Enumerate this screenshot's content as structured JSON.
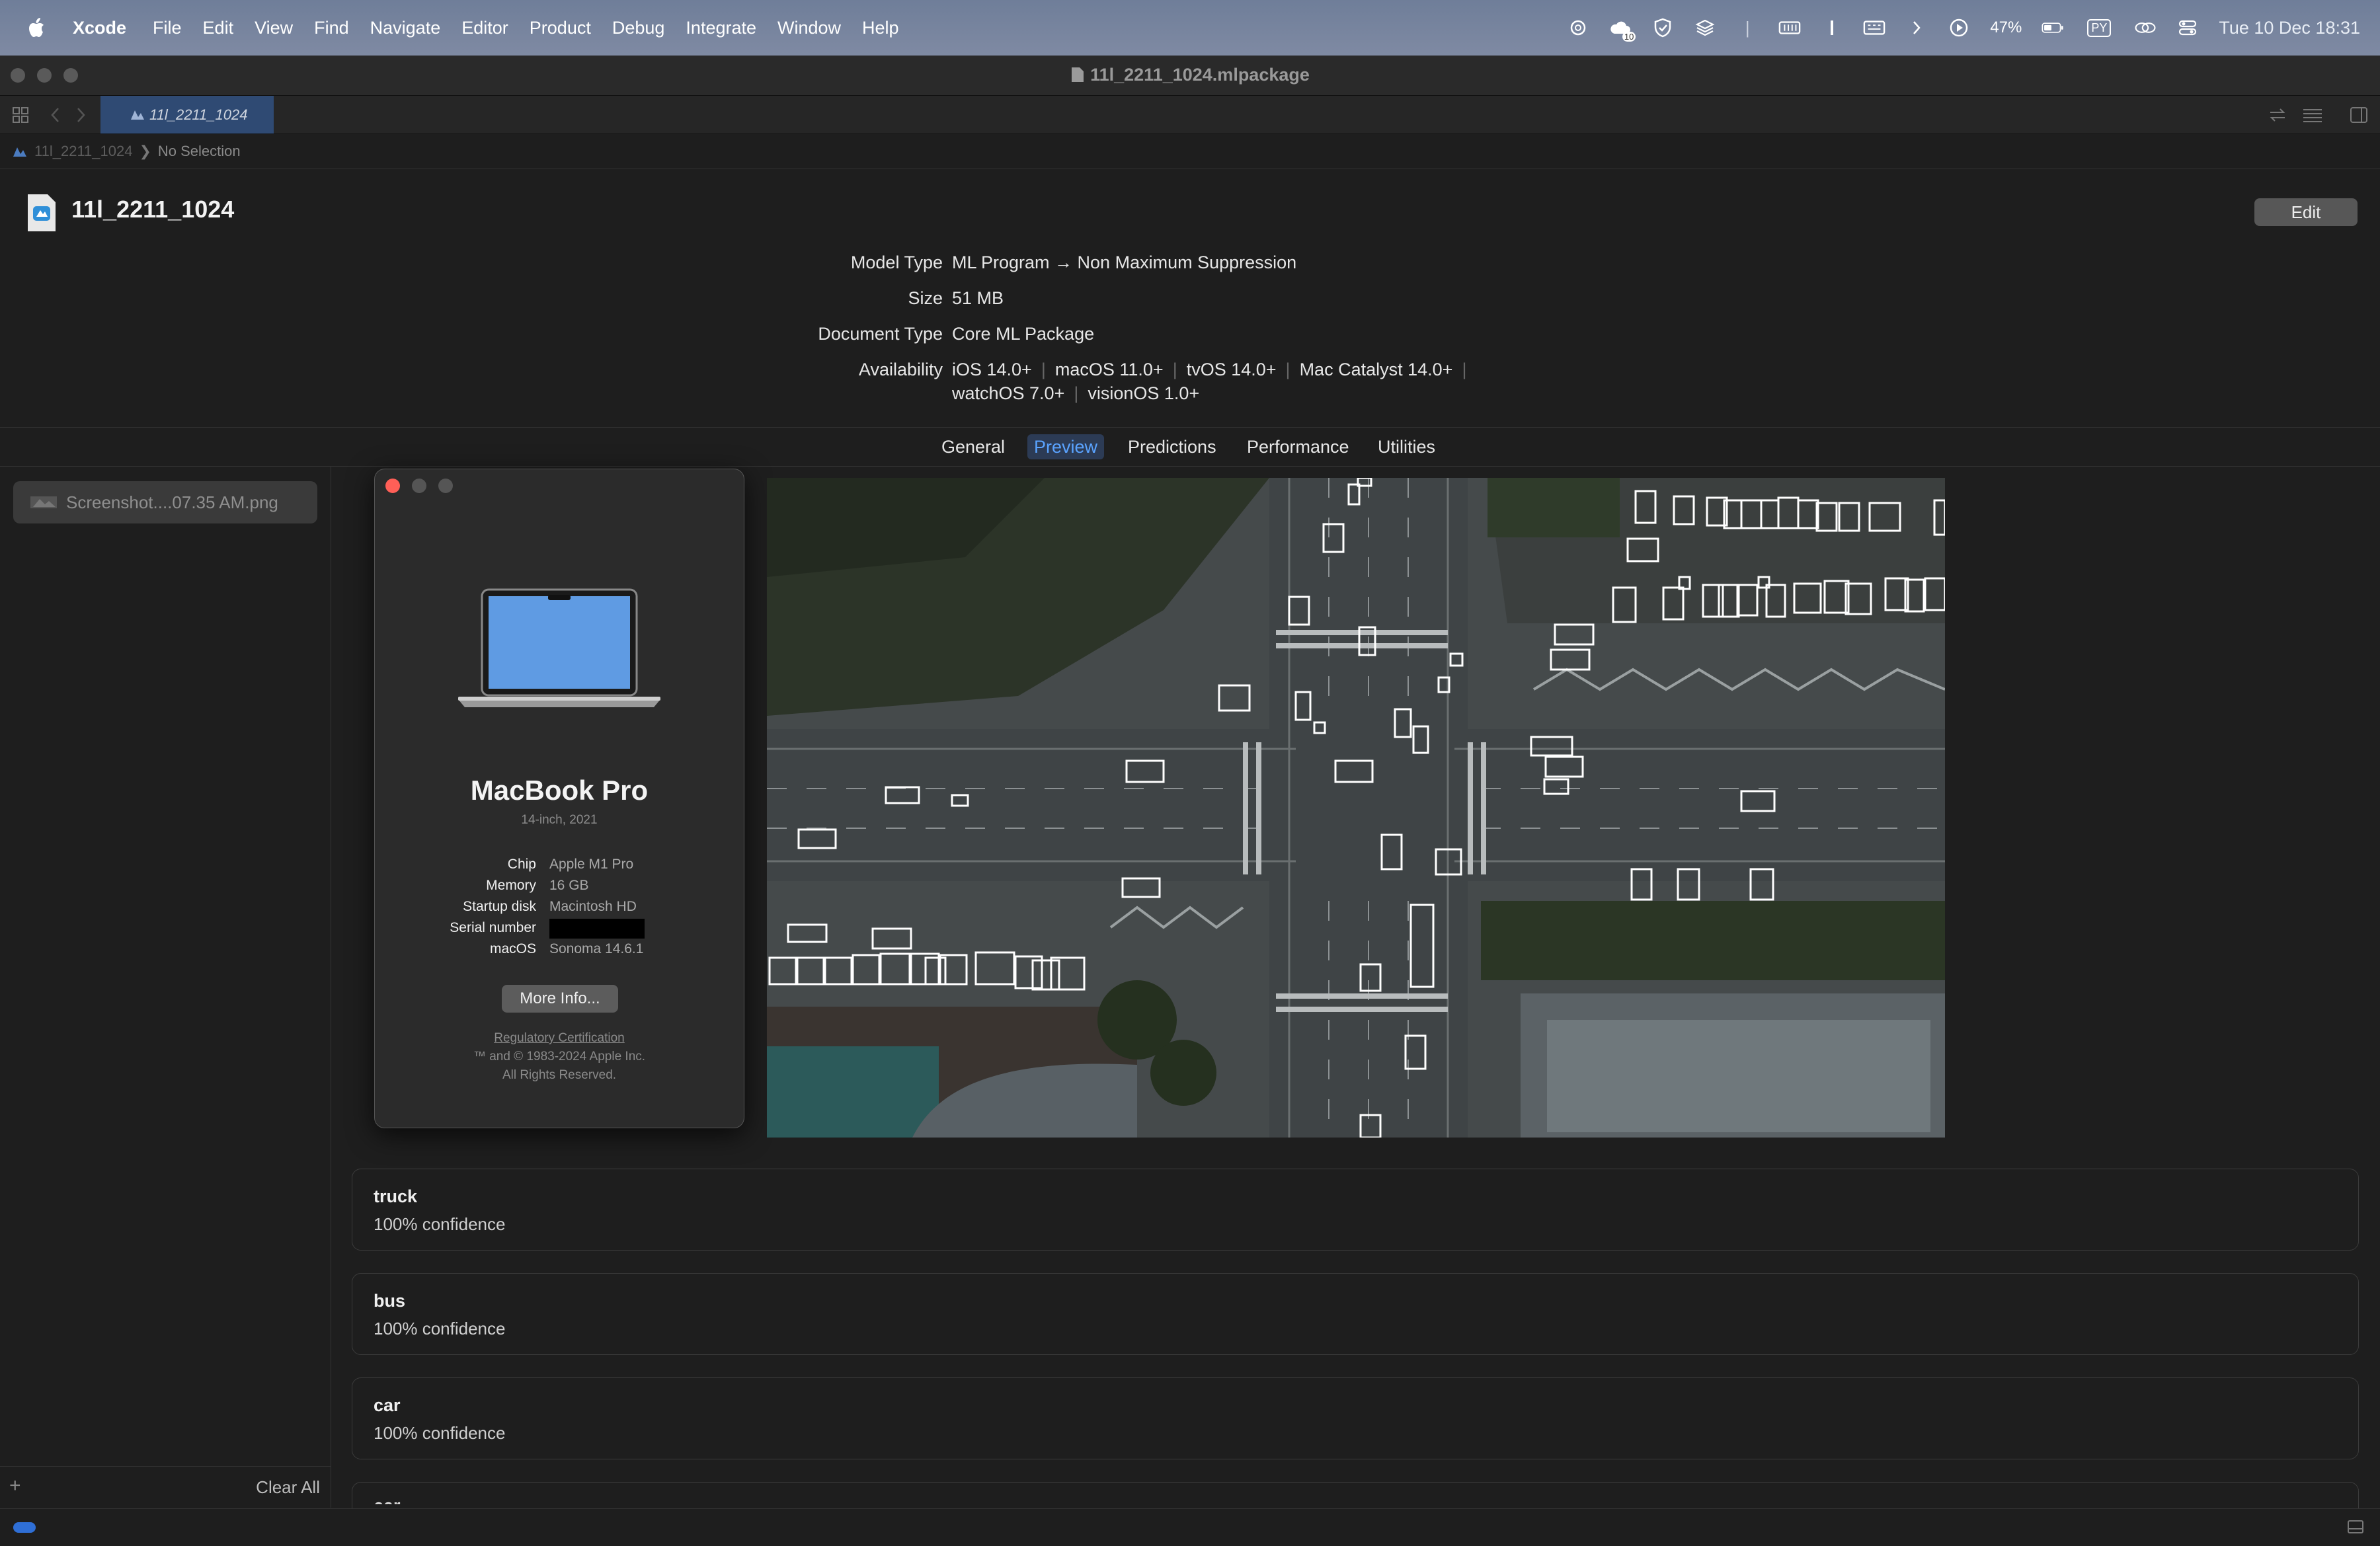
{
  "menubar": {
    "app": "Xcode",
    "items": [
      "File",
      "Edit",
      "View",
      "Find",
      "Navigate",
      "Editor",
      "Product",
      "Debug",
      "Integrate",
      "Window",
      "Help"
    ],
    "battery_pct": "47%",
    "input_indicator": "PY",
    "datetime": "Tue 10 Dec  18:31",
    "badge_count": "10"
  },
  "window": {
    "title": "11l_2211_1024.mlpackage",
    "tab_label": "11l_2211_1024",
    "breadcrumb_file": "11l_2211_1024",
    "breadcrumb_selection": "No Selection"
  },
  "model": {
    "name": "11l_2211_1024",
    "edit_label": "Edit",
    "metadata": [
      {
        "label": "Model Type",
        "value": "ML Program → Non Maximum Suppression"
      },
      {
        "label": "Size",
        "value": "51 MB"
      },
      {
        "label": "Document Type",
        "value": "Core ML Package"
      }
    ],
    "availability_label": "Availability",
    "availability": [
      "iOS 14.0+",
      "macOS 11.0+",
      "tvOS 14.0+",
      "Mac Catalyst 14.0+",
      "watchOS 7.0+",
      "visionOS 1.0+"
    ]
  },
  "tabs": [
    "General",
    "Preview",
    "Predictions",
    "Performance",
    "Utilities"
  ],
  "active_tab": "Preview",
  "sidebar": {
    "file": "Screenshot....07.35 AM.png",
    "add_label": "+",
    "clear_all": "Clear All"
  },
  "about_mac": {
    "title": "MacBook Pro",
    "subtitle": "14-inch, 2021",
    "specs": [
      {
        "label": "Chip",
        "value": "Apple M1 Pro"
      },
      {
        "label": "Memory",
        "value": "16 GB"
      },
      {
        "label": "Startup disk",
        "value": "Macintosh HD"
      },
      {
        "label": "Serial number",
        "value": ""
      },
      {
        "label": "macOS",
        "value": "Sonoma 14.6.1"
      }
    ],
    "more_info": "More Info...",
    "regulatory": "Regulatory Certification",
    "copyright": "™ and © 1983-2024 Apple Inc.",
    "rights": "All Rights Reserved."
  },
  "predictions": [
    {
      "label": "truck",
      "confidence": "100% confidence"
    },
    {
      "label": "bus",
      "confidence": "100% confidence"
    },
    {
      "label": "car",
      "confidence": "100% confidence"
    },
    {
      "label": "car",
      "confidence": ""
    }
  ],
  "colors": {
    "accent": "#5aa3ff",
    "detection_box": "#ffffff",
    "menubar": "#7483a0"
  }
}
